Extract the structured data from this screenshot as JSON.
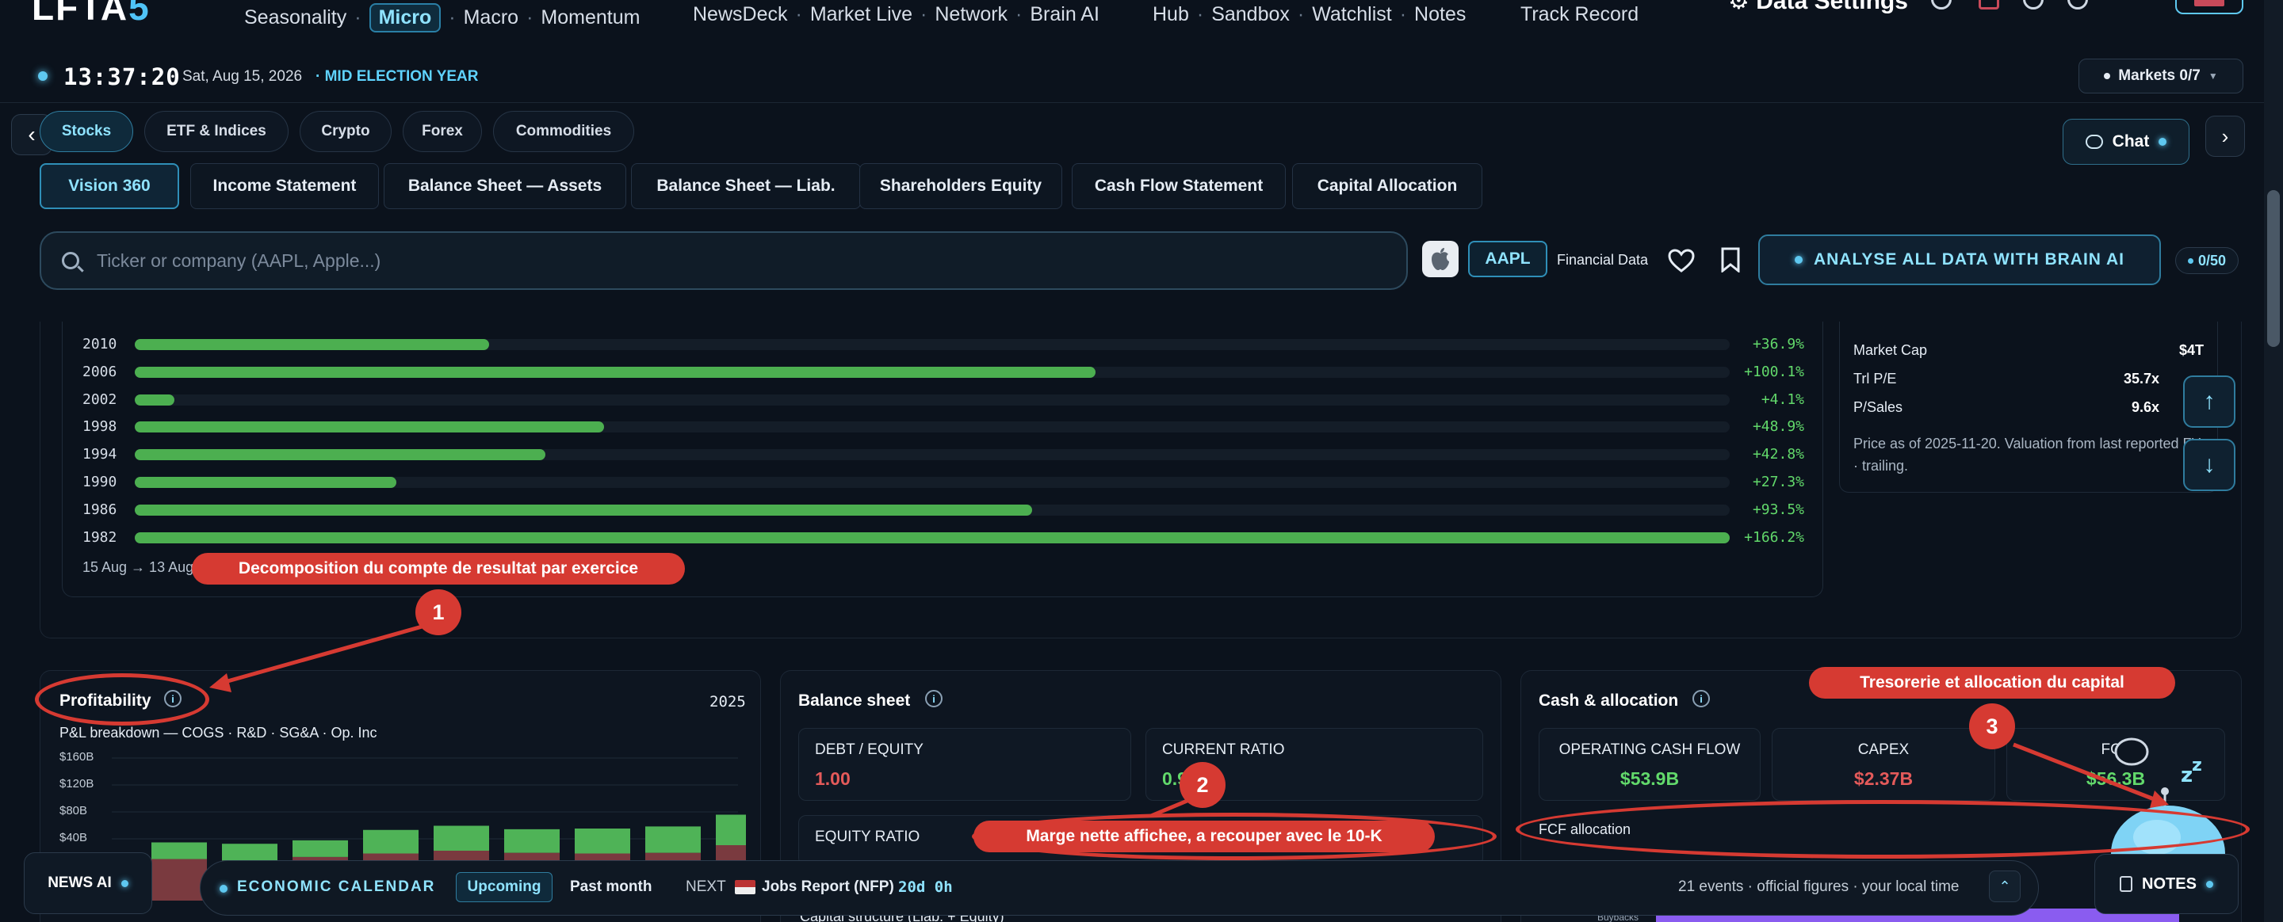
{
  "logo": {
    "text_main": "LFTA",
    "text_accent": "5"
  },
  "nav": {
    "group1": [
      "Seasonality",
      "Micro",
      "Macro",
      "Momentum"
    ],
    "active": "Micro",
    "group2": [
      "NewsDeck",
      "Market Live",
      "Network",
      "Brain AI"
    ],
    "group3": [
      "Hub",
      "Sandbox",
      "Watchlist",
      "Notes"
    ],
    "group4": "Track Record",
    "data_settings": "Data Settings"
  },
  "status": {
    "time": "13:37:20",
    "date": "Sat, Aug 15, 2026",
    "election": "MID ELECTION YEAR",
    "markets": "Markets 0/7"
  },
  "asset_tabs": [
    "Stocks",
    "ETF & Indices",
    "Crypto",
    "Forex",
    "Commodities"
  ],
  "asset_active": "Stocks",
  "chat_label": "Chat",
  "statement_tabs": [
    "Vision 360",
    "Income Statement",
    "Balance Sheet — Assets",
    "Balance Sheet — Liab.",
    "Shareholders Equity",
    "Cash Flow Statement",
    "Capital Allocation"
  ],
  "search": {
    "placeholder": "Ticker or company (AAPL, Apple...)"
  },
  "ticker": "AAPL",
  "financial_data_label": "Financial Data",
  "brain_button": "ANALYSE ALL DATA WITH BRAIN AI",
  "quota": "0/50",
  "bars": {
    "rows": [
      {
        "year": "2010",
        "value": 36.9,
        "label": "+36.9%"
      },
      {
        "year": "2006",
        "value": 100.1,
        "label": "+100.1%"
      },
      {
        "year": "2002",
        "value": 4.1,
        "label": "+4.1%"
      },
      {
        "year": "1998",
        "value": 48.9,
        "label": "+48.9%"
      },
      {
        "year": "1994",
        "value": 42.8,
        "label": "+42.8%"
      },
      {
        "year": "1990",
        "value": 27.3,
        "label": "+27.3%"
      },
      {
        "year": "1986",
        "value": 93.5,
        "label": "+93.5%"
      },
      {
        "year": "1982",
        "value": 166.2,
        "label": "+166.2%"
      }
    ],
    "max": 166.2,
    "range_label": "15 Aug → 13 Aug"
  },
  "valuation": {
    "rows": [
      {
        "label": "Market Cap",
        "value": "$4T"
      },
      {
        "label": "Trl P/E",
        "value": "35.7x"
      },
      {
        "label": "P/Sales",
        "value": "9.6x"
      }
    ],
    "note": "Price as of 2025-11-20. Valuation from last reported FY · trailing."
  },
  "profitability": {
    "title": "Profitability",
    "year": "2025",
    "subtitle": "P&L breakdown — COGS · R&D · SG&A · Op. Inc",
    "y_ticks": [
      "$160B",
      "$120B",
      "$80B",
      "$40B"
    ]
  },
  "chart_data": {
    "type": "bar",
    "title": "P&L breakdown — COGS · R&D · SG&A · Op. Inc",
    "ylim": [
      0,
      160
    ],
    "yticks": [
      "$160B",
      "$120B",
      "$80B",
      "$40B"
    ],
    "stack_heights": [
      84,
      82,
      87,
      102,
      108,
      103,
      104,
      107,
      124
    ],
    "segments": [
      "COGS",
      "R&D",
      "SG&A",
      "Op. Inc"
    ],
    "top_segment": [
      24,
      24,
      24,
      34,
      36,
      34,
      36,
      38,
      44
    ]
  },
  "balance": {
    "title": "Balance sheet",
    "debt_equity_label": "DEBT / EQUITY",
    "debt_equity_value": "1.00",
    "current_ratio_label": "CURRENT RATIO",
    "current_ratio_value": "0.9",
    "equity_ratio_label": "EQUITY RATIO",
    "capital_structure": "Capital structure (Liab. + Equity)"
  },
  "cash": {
    "title": "Cash & allocation",
    "ocf_label": "OPERATING CASH FLOW",
    "ocf_value": "$53.9B",
    "capex_label": "CAPEX",
    "capex_value": "$2.37B",
    "fcf_label": "FCF",
    "fcf_value": "$56.3B",
    "fcf_allocation": "FCF allocation",
    "buybacks": "Buybacks"
  },
  "bottom": {
    "news_ai": "NEWS AI",
    "econ_label": "ECONOMIC CALENDAR",
    "upcoming": "Upcoming",
    "past_month": "Past month",
    "next_label": "NEXT",
    "next_event": "Jobs Report (NFP)",
    "countdown": "20d 0h",
    "events_info": "21 events · official figures · your local time",
    "notes": "NOTES"
  },
  "annotations": {
    "a1_label": "Decomposition du compte de resultat par exercice",
    "a1_num": "1",
    "a2_label": "Marge nette affichee, a recouper avec le 10-K",
    "a2_num": "2",
    "a3_label": "Tresorerie et allocation du capital",
    "a3_num": "3"
  },
  "colors": {
    "accent": "#5ec8f0",
    "positive": "#4caf50",
    "negative": "#e45a5a",
    "annotation": "#d63a32"
  }
}
